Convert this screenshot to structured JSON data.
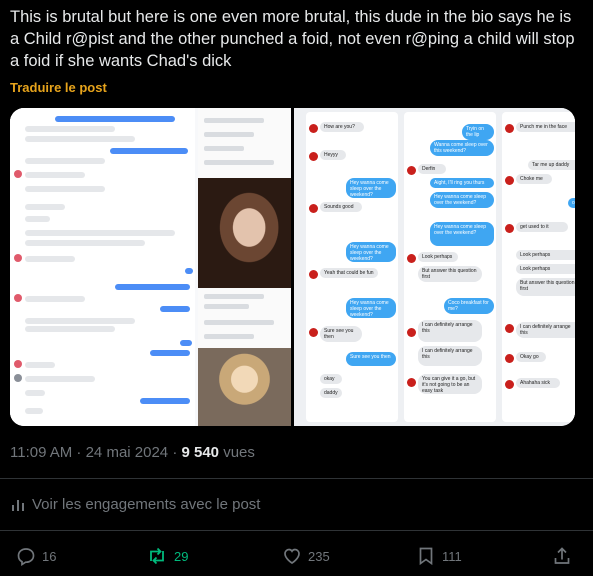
{
  "post": {
    "text": "This is brutal but here is one even more brutal, this dude in the bio says he is a Child r@pist and the other punched a foid, not even r@ping a child will stop a foid if she wants Chad's dick",
    "translate_label": "Traduire le post",
    "timestamp": "11:09 AM · 24 mai 2024 · ",
    "views_count": "9 540",
    "views_label": " vues",
    "engagements_label": "Voir les engagements avec le post"
  },
  "actions": {
    "replies": "16",
    "reposts": "29",
    "likes": "235",
    "bookmarks": "111"
  },
  "colors": {
    "background": "#000000",
    "text": "#e7e9ea",
    "muted": "#71767b",
    "translate": "#e7a41c",
    "repost_active": "#00ba7c"
  },
  "media": {
    "right_messages": [
      "How are you?",
      "Heyyy",
      "Hey wanna come sleep over the weekend?",
      "Sounds good",
      "Yeah that could be fun",
      "Sure see you then",
      "okay",
      "daddy",
      "Tryin on the lip",
      "Wanna come sleep over this weekend?",
      "Derfin",
      "Aight, I'll ring you thurs",
      "Look perhaps",
      "But answer this question first",
      "Coco breakfast for me?",
      "I can definitely arrange this",
      "You can give it a go, but it's not going to be an easy task",
      "Punch me in the face",
      "Tar me up daddy",
      "Choke me",
      "get used to it",
      "Okay go",
      "Ahahaha sick"
    ]
  }
}
